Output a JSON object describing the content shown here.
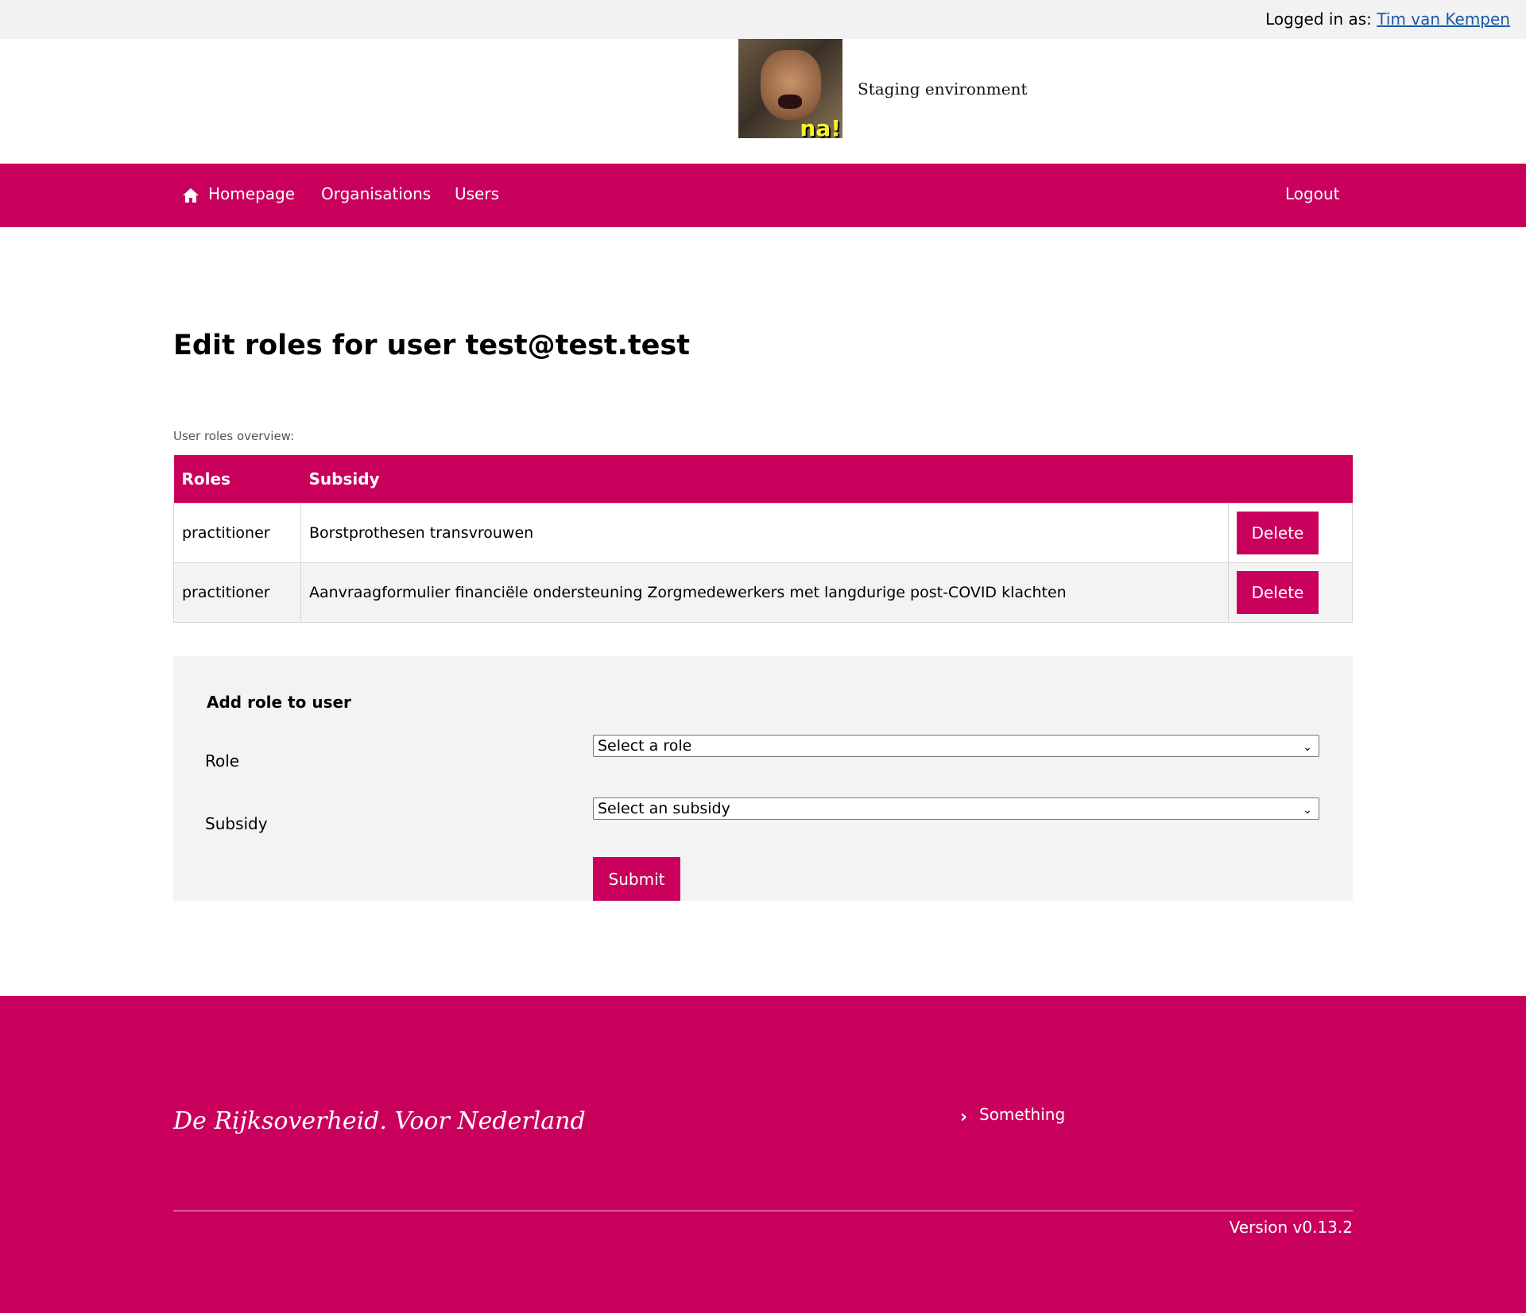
{
  "topbar": {
    "logged_in_prefix": "Logged in as:",
    "user_name": "Tim van Kempen"
  },
  "header": {
    "logo_text": "na!",
    "environment": "Staging environment"
  },
  "nav": {
    "home_label": "Homepage",
    "organisations_label": "Organisations",
    "users_label": "Users",
    "logout_label": "Logout",
    "home_icon": "home-icon"
  },
  "page": {
    "title": "Edit roles for user test@test.test",
    "overview_label": "User roles overview:"
  },
  "roles_table": {
    "headers": [
      "Roles",
      "Subsidy"
    ],
    "rows": [
      {
        "role": "practitioner",
        "subsidy": "Borstprothesen transvrouwen",
        "action": "Delete"
      },
      {
        "role": "practitioner",
        "subsidy": "Aanvraagformulier financiële ondersteuning Zorgmedewerkers met langdurige post-COVID klachten",
        "action": "Delete"
      }
    ]
  },
  "add_role": {
    "title": "Add role to user",
    "role_label": "Role",
    "role_select": "Select a role",
    "subsidy_label": "Subsidy",
    "subsidy_select": "Select an subsidy",
    "submit_label": "Submit"
  },
  "footer": {
    "tagline": "De Rijksoverheid. Voor Nederland",
    "link_label": "Something",
    "version": "Version v0.13.2"
  },
  "colors": {
    "brand": "#ca005d",
    "topbar": "#f2f2f2",
    "panel": "#f3f3f3",
    "link": "#1a5aa8"
  }
}
